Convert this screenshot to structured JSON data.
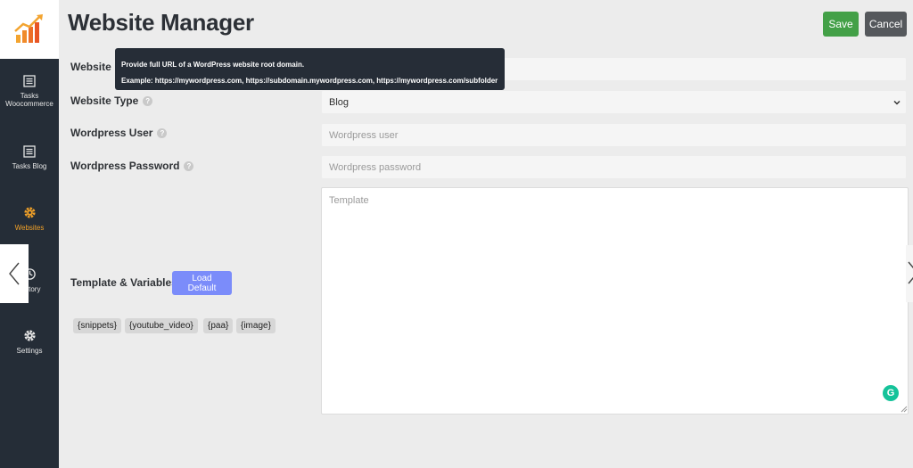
{
  "header": {
    "title": "Website Manager",
    "save_label": "Save",
    "cancel_label": "Cancel"
  },
  "sidebar": {
    "items": [
      {
        "label": "Tasks Woocommerce",
        "icon": "list-icon",
        "active": false
      },
      {
        "label": "Tasks Blog",
        "icon": "list-icon",
        "active": false
      },
      {
        "label": "Websites",
        "icon": "gear-icon",
        "active": true
      },
      {
        "label": "History",
        "icon": "clock-icon",
        "active": false
      },
      {
        "label": "Settings",
        "icon": "gear-icon",
        "active": false
      }
    ]
  },
  "form": {
    "website_label": "Website",
    "website_type_label": "Website Type",
    "website_type_value": "Blog",
    "wp_user_label": "Wordpress User",
    "wp_user_placeholder": "Wordpress user",
    "wp_password_label": "Wordpress Password",
    "wp_password_placeholder": "Wordpress password",
    "template_label": "Template & Variables",
    "template_placeholder": "Template",
    "load_default_label": "Load Default",
    "variables": [
      "{snippets}",
      "{youtube_video}",
      "{paa}",
      "{image}"
    ]
  },
  "tooltip": {
    "line1": "Provide full URL of a WordPress website root domain.",
    "line2": "Example: https://mywordpress.com, https://subdomain.mywordpress.com, https://mywordpress.com/subfolder"
  },
  "help_glyph": "?",
  "grammarly_glyph": "G",
  "colors": {
    "sidebar_bg": "#252d37",
    "active_nav": "#f0a028",
    "save_button": "#43a047",
    "cancel_button": "#55585c",
    "load_default_button": "#7b8cfa",
    "grammarly": "#15c39a"
  }
}
